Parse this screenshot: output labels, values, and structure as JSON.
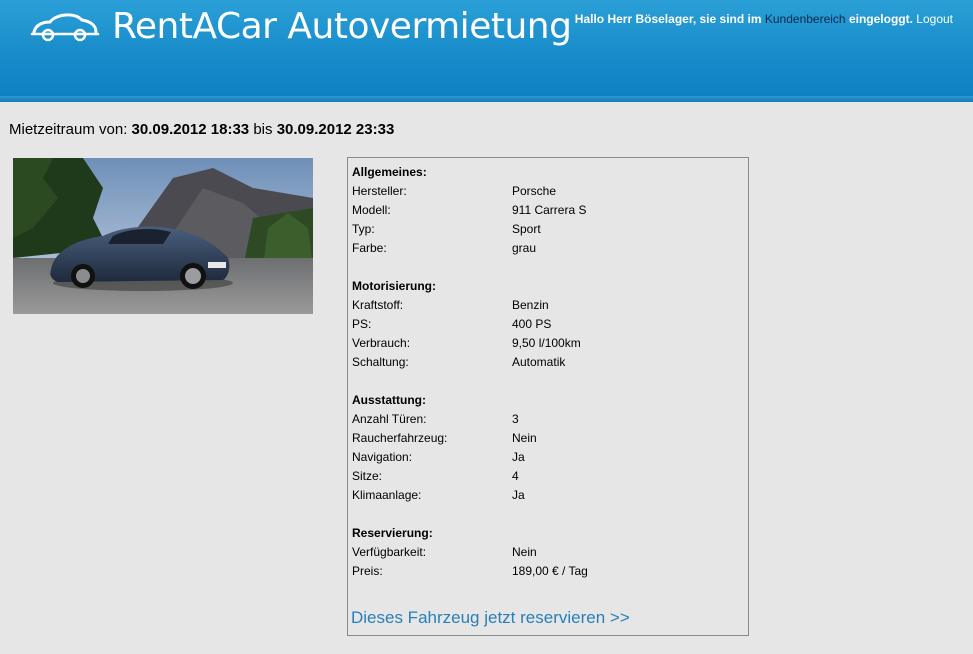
{
  "header": {
    "brand": "RentACar Autovermietung",
    "greeting": "Hallo Herr Böselager, sie sind im",
    "area_link": "Kundenbereich",
    "greeting_end": "eingeloggt.",
    "logout": "Logout"
  },
  "period": {
    "label": "Mietzeitraum von:",
    "from": "30.09.2012 18:33",
    "to_word": "bis",
    "to": "30.09.2012 23:33"
  },
  "car_image": {
    "icon": "porsche-911-photo"
  },
  "details": {
    "general": {
      "title": "Allgemeines:",
      "rows": [
        {
          "label": "Hersteller:",
          "value": "Porsche"
        },
        {
          "label": "Modell:",
          "value": "911 Carrera S"
        },
        {
          "label": "Typ:",
          "value": "Sport"
        },
        {
          "label": "Farbe:",
          "value": "grau"
        }
      ]
    },
    "engine": {
      "title": "Motorisierung:",
      "rows": [
        {
          "label": "Kraftstoff:",
          "value": "Benzin"
        },
        {
          "label": "PS:",
          "value": "400 PS"
        },
        {
          "label": "Verbrauch:",
          "value": "9,50 l/100km"
        },
        {
          "label": "Schaltung:",
          "value": "Automatik"
        }
      ]
    },
    "equipment": {
      "title": "Ausstattung:",
      "rows": [
        {
          "label": "Anzahl Türen:",
          "value": "3"
        },
        {
          "label": "Raucherfahrzeug:",
          "value": "Nein"
        },
        {
          "label": "Navigation:",
          "value": "Ja"
        },
        {
          "label": "Sitze:",
          "value": "4"
        },
        {
          "label": "Klimaanlage:",
          "value": "Ja"
        }
      ]
    },
    "reservation": {
      "title": "Reservierung:",
      "rows": [
        {
          "label": "Verfügbarkeit:",
          "value": "Nein"
        },
        {
          "label": "Preis:",
          "value": "189,00 € / Tag"
        }
      ]
    }
  },
  "reserve_link": "Dieses Fahrzeug jetzt reservieren >>",
  "colors": {
    "header_blue": "#1a8fcc",
    "link_blue": "#2a7fb8",
    "background": "#e6e6e6"
  }
}
